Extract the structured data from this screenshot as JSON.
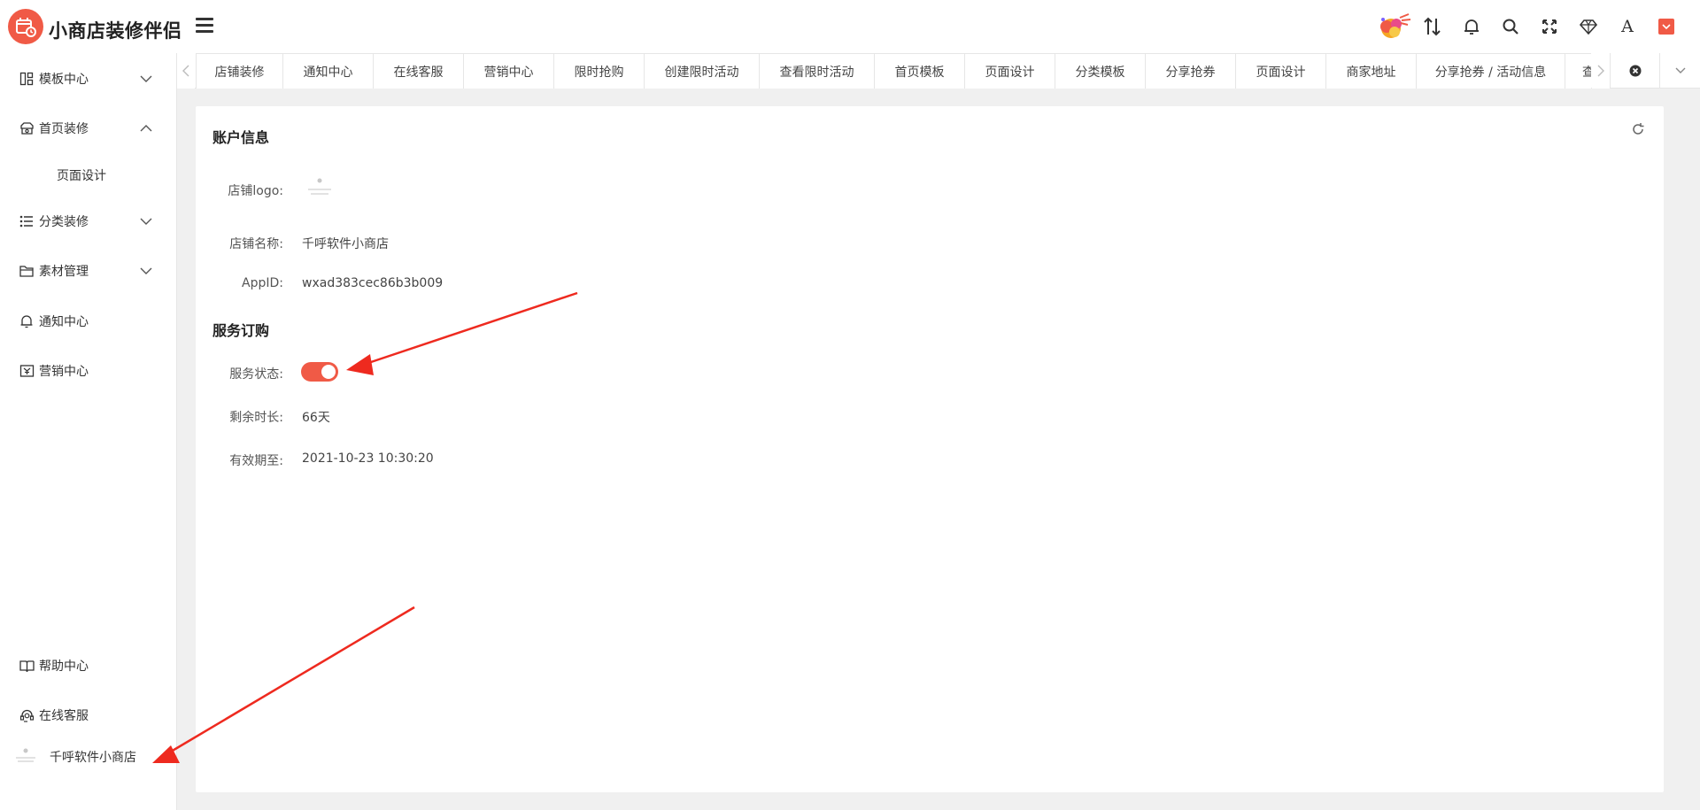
{
  "app": {
    "title": "小商店装修伴侣",
    "brand_color": "#f05a46"
  },
  "header": {
    "icons": [
      "avatar-art",
      "sort-icon",
      "bell-icon",
      "search-icon",
      "fullscreen-icon",
      "diamond-icon",
      "font-icon",
      "theme-color-icon"
    ],
    "font_letter": "A"
  },
  "sidebar": {
    "items": [
      {
        "label": "模板中心",
        "icon": "template-icon",
        "expandable": true,
        "expanded": false
      },
      {
        "label": "首页装修",
        "icon": "home-design-icon",
        "expandable": true,
        "expanded": true,
        "children": [
          {
            "label": "页面设计"
          }
        ]
      },
      {
        "label": "分类装修",
        "icon": "list-icon",
        "expandable": true,
        "expanded": false
      },
      {
        "label": "素材管理",
        "icon": "folder-icon",
        "expandable": true,
        "expanded": false
      },
      {
        "label": "通知中心",
        "icon": "bell-icon",
        "expandable": false
      },
      {
        "label": "营销中心",
        "icon": "coupon-icon",
        "expandable": false
      }
    ],
    "bottom": [
      {
        "label": "帮助中心",
        "icon": "book-icon"
      },
      {
        "label": "在线客服",
        "icon": "headset-icon"
      }
    ],
    "store": {
      "name": "千呼软件小商店"
    }
  },
  "tabs": [
    "店铺装修",
    "通知中心",
    "在线客服",
    "营销中心",
    "限时抢购",
    "创建限时活动",
    "查看限时活动",
    "首页模板",
    "页面设计",
    "分类模板",
    "分享抢券",
    "页面设计",
    "商家地址",
    "分享抢券 / 活动信息",
    "查"
  ],
  "account": {
    "section_title": "账户信息",
    "logo_label": "店铺logo:",
    "name_label": "店铺名称:",
    "name_value": "千呼软件小商店",
    "appid_label": "AppID:",
    "appid_value": "wxad383cec86b3b009"
  },
  "service": {
    "section_title": "服务订购",
    "status_label": "服务状态:",
    "status_on": true,
    "remaining_label": "剩余时长:",
    "remaining_value": "66天",
    "expiry_label": "有效期至:",
    "expiry_value": "2021-10-23 10:30:20"
  },
  "annotation_color": "#ee2a1f"
}
